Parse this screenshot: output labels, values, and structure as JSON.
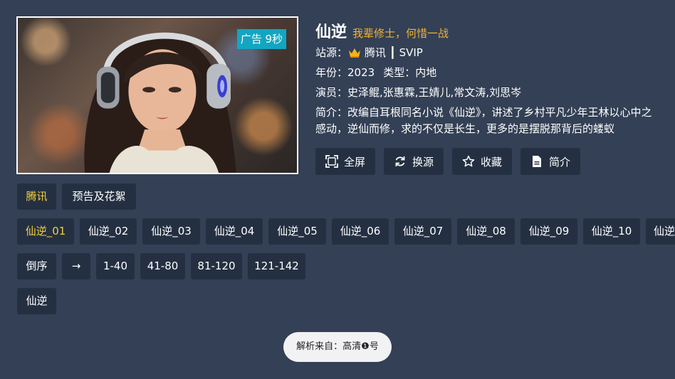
{
  "player": {
    "ad_text": "广告 9秒"
  },
  "detail": {
    "title": "仙逆",
    "slogan": "我辈修士，何惜一战",
    "source": "站源：",
    "source_value": "腾讯 ┃ SVIP",
    "year_label": "年份：2023",
    "type_label": "类型：内地",
    "cast": "演员：史泽鲲,张惠霖,王婧儿,常文涛,刘思岑",
    "intro": "简介：改编自耳根同名小说《仙逆》，讲述了乡村平凡少年王林以心中之感动，逆仙而修，求的不仅是长生，更多的是摆脱那背后的蝼蚁"
  },
  "actions": [
    {
      "label": "全屏",
      "icon": "fullscreen-icon"
    },
    {
      "label": "换源",
      "icon": "refresh-icon"
    },
    {
      "label": "收藏",
      "icon": "star-icon"
    },
    {
      "label": "简介",
      "icon": "document-icon"
    }
  ],
  "sources": [
    "腾讯",
    "预告及花絮"
  ],
  "episodes": [
    "仙逆_01",
    "仙逆_02",
    "仙逆_03",
    "仙逆_04",
    "仙逆_05",
    "仙逆_06",
    "仙逆_07",
    "仙逆_08",
    "仙逆_09",
    "仙逆_10",
    "仙逆"
  ],
  "ranges": [
    "倒序",
    "→",
    "1-40",
    "41-80",
    "81-120",
    "121-142"
  ],
  "parts": [
    "仙逆"
  ],
  "toast": "解析来自：高清❶号",
  "colors": {
    "background": "#334055",
    "chip": "#243042",
    "active": "#f4cf3a",
    "slogan": "#f2b233",
    "ad_badge": "#12a6c2"
  }
}
